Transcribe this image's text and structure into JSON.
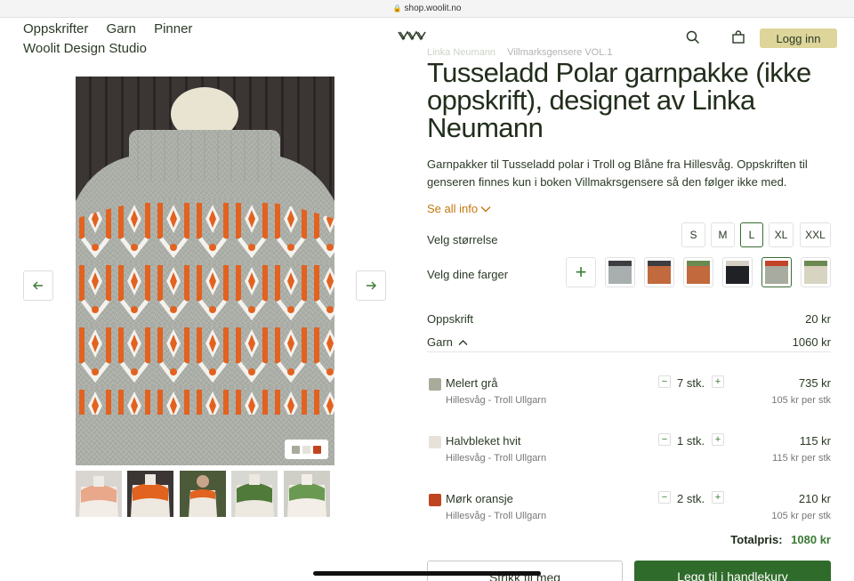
{
  "browser": {
    "url": "shop.woolit.no"
  },
  "nav": {
    "items": [
      "Oppskrifter",
      "Garn",
      "Pinner"
    ],
    "studio": "Woolit Design Studio"
  },
  "header": {
    "login_label": "Logg inn",
    "search_icon": "search-icon",
    "bag_icon": "shopping-bag-icon"
  },
  "breadcrumb": {
    "designer": "Linka Neumann",
    "collection": "Villmarksgensere VOL.1"
  },
  "product": {
    "title": "Tusseladd Polar garnpakke (ikke oppskrift), designet av Linka Neumann",
    "description": "Garnpakker til Tusseladd polar i Troll og Blåne fra Hillesvåg. Oppskriften til genseren finnes kun i boken Villmakrsgensere så den følger ikke med.",
    "see_all": "Se all info"
  },
  "size": {
    "label": "Velg størrelse",
    "options": [
      "S",
      "M",
      "L",
      "XL",
      "XXL"
    ],
    "selected": "L"
  },
  "colors": {
    "label": "Velg dine farger",
    "swatches": [
      {
        "top": "#3b3d40",
        "bottom": "#a9afaf"
      },
      {
        "top": "#3b3d40",
        "bottom": "#c2693d"
      },
      {
        "top": "#6a8a52",
        "bottom": "#c2693d"
      },
      {
        "top": "#d6d0c4",
        "bottom": "#1f2124"
      },
      {
        "top": "#c2452a",
        "bottom": "#a8ab9f",
        "selected": true
      },
      {
        "top": "#6a8a52",
        "bottom": "#d8d4c2"
      }
    ]
  },
  "pricing": {
    "pattern_label": "Oppskrift",
    "pattern_price": "20 kr",
    "yarn_label": "Garn",
    "yarn_price": "1060 kr"
  },
  "yarns": [
    {
      "name": "Melert grå",
      "brand": "Hillesvåg - Troll Ullgarn",
      "qty": "7 stk.",
      "price": "735 kr",
      "per": "105 kr per stk",
      "color": "#a8ab9a"
    },
    {
      "name": "Halvbleket hvit",
      "brand": "Hillesvåg - Troll Ullgarn",
      "qty": "1 stk.",
      "price": "115 kr",
      "per": "115 kr per stk",
      "color": "#e6e2da"
    },
    {
      "name": "Mørk oransje",
      "brand": "Hillesvåg - Troll Ullgarn",
      "qty": "2 stk.",
      "price": "210 kr",
      "per": "105 kr per stk",
      "color": "#c0441f"
    }
  ],
  "total": {
    "label": "Totalpris:",
    "amount": "1080 kr"
  },
  "actions": {
    "knit_label": "Strikk til meg",
    "cart_label": "Legg til i handlekurv"
  },
  "image_colors": [
    "#a8ab9a",
    "#e6e2da",
    "#c0441f"
  ]
}
